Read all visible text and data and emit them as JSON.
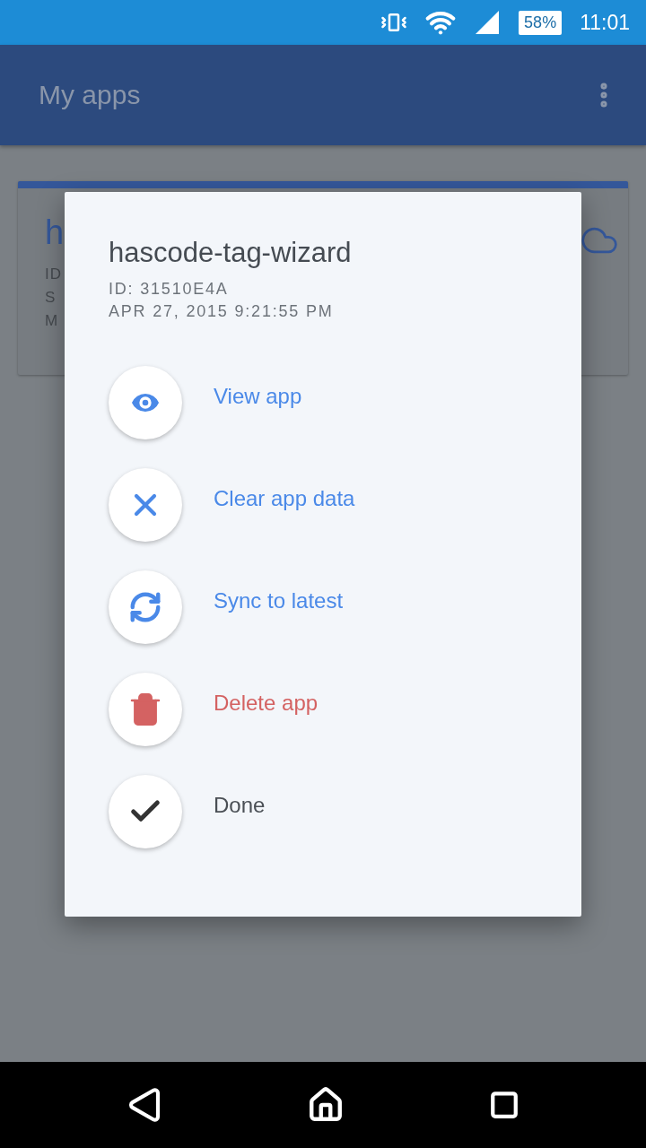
{
  "status_bar": {
    "battery": "58%",
    "time": "11:01"
  },
  "app_bar": {
    "title": "My apps"
  },
  "card": {
    "title": "h",
    "lines": [
      "ID",
      "S",
      "M"
    ]
  },
  "dialog": {
    "title": "hascode-tag-wizard",
    "id": "ID: 31510E4A",
    "date": "APR 27, 2015 9:21:55 PM",
    "actions": [
      {
        "kind": "view",
        "label": "View app"
      },
      {
        "kind": "clear",
        "label": "Clear app data"
      },
      {
        "kind": "sync",
        "label": "Sync to latest"
      },
      {
        "kind": "delete",
        "label": "Delete app"
      },
      {
        "kind": "done",
        "label": "Done"
      }
    ]
  }
}
